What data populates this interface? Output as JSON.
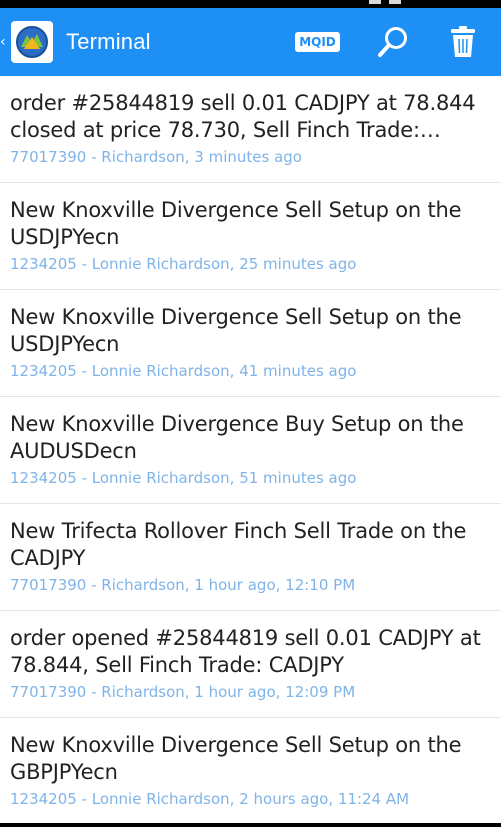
{
  "app_bar": {
    "title": "Terminal",
    "mqid_label": "MQID",
    "background": "#1e90f5",
    "icons": [
      "chevron-left-icon",
      "metatrader-logo-icon",
      "search-icon",
      "trash-icon"
    ]
  },
  "messages": [
    {
      "text": "order #25844819 sell 0.01 CADJPY at 78.844 closed at price 78.730, Sell Finch Trade:…",
      "meta": "77017390 - Richardson, 3 minutes ago"
    },
    {
      "text": "New Knoxville Divergence Sell Setup on the USDJPYecn",
      "meta": "1234205 - Lonnie Richardson, 25 minutes ago"
    },
    {
      "text": "New Knoxville Divergence Sell Setup on the USDJPYecn",
      "meta": "1234205 - Lonnie Richardson, 41 minutes ago"
    },
    {
      "text": "New Knoxville Divergence Buy Setup on the AUDUSDecn",
      "meta": "1234205 - Lonnie Richardson, 51 minutes ago"
    },
    {
      "text": "New Trifecta Rollover Finch Sell Trade on the CADJPY",
      "meta": "77017390 - Richardson, 1 hour ago, 12:10 PM"
    },
    {
      "text": "order opened #25844819 sell 0.01 CADJPY at 78.844, Sell Finch Trade: CADJPY",
      "meta": "77017390 - Richardson, 1 hour ago, 12:09 PM"
    },
    {
      "text": "New Knoxville Divergence Sell Setup on the GBPJPYecn",
      "meta": "1234205 - Lonnie Richardson, 2 hours ago, 11:24 AM"
    }
  ],
  "colors": {
    "message_text": "#222222",
    "meta_text": "#7fb4e8",
    "divider": "#e6e6e6"
  }
}
